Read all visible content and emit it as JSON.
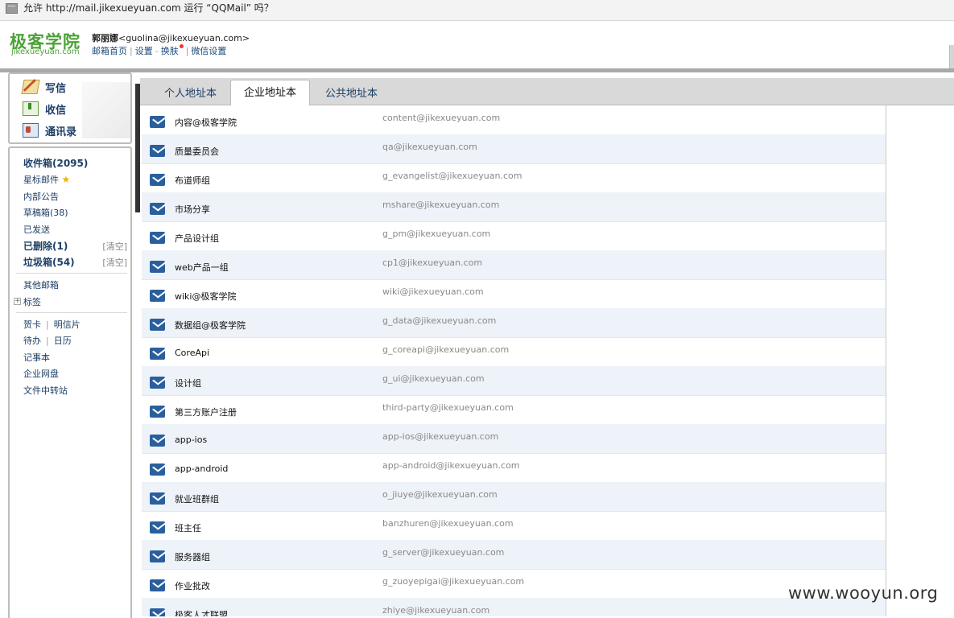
{
  "permission_bar": {
    "text": "允许 http://mail.jikexueyuan.com 运行 “QQMail” 吗？"
  },
  "header": {
    "logo_cn": "极客学院",
    "logo_en": "jikexueyuan.com",
    "user_name": "郭丽娜",
    "user_email": "<guolina@jikexueyuan.com>",
    "links": [
      "邮箱首页",
      "设置",
      "换肤",
      "微信设置"
    ]
  },
  "sidebar": {
    "actions": [
      "写信",
      "收信",
      "通讯录"
    ],
    "folders": {
      "inbox": "收件箱(2095)",
      "starred": "星标邮件",
      "notice": "内部公告",
      "drafts": "草稿箱(38)",
      "sent": "已发送",
      "deleted": "已删除(1)",
      "spam": "垃圾箱(54)",
      "clear": "[清空]"
    },
    "other_mailbox": "其他邮箱",
    "tags": "标签",
    "tools": {
      "card": "贺卡",
      "postcard": "明信片",
      "todo": "待办",
      "calendar": "日历",
      "notes": "记事本",
      "netdisk": "企业网盘",
      "transfer": "文件中转站"
    }
  },
  "tabs": [
    "个人地址本",
    "企业地址本",
    "公共地址本"
  ],
  "contacts": [
    {
      "name": "内容@极客学院",
      "email": "content@jikexueyuan.com"
    },
    {
      "name": "质量委员会",
      "email": "qa@jikexueyuan.com"
    },
    {
      "name": "布道师组",
      "email": "g_evangelist@jikexueyuan.com"
    },
    {
      "name": "市场分享",
      "email": "mshare@jikexueyuan.com"
    },
    {
      "name": "产品设计组",
      "email": "g_pm@jikexueyuan.com"
    },
    {
      "name": "web产品一组",
      "email": "cp1@jikexueyuan.com"
    },
    {
      "name": "wiki@极客学院",
      "email": "wiki@jikexueyuan.com"
    },
    {
      "name": "数据组@极客学院",
      "email": "g_data@jikexueyuan.com"
    },
    {
      "name": "CoreApi",
      "email": "g_coreapi@jikexueyuan.com"
    },
    {
      "name": "设计组",
      "email": "g_ui@jikexueyuan.com"
    },
    {
      "name": "第三方账户注册",
      "email": "third-party@jikexueyuan.com"
    },
    {
      "name": "app-ios",
      "email": "app-ios@jikexueyuan.com"
    },
    {
      "name": "app-android",
      "email": "app-android@jikexueyuan.com"
    },
    {
      "name": "就业班群组",
      "email": "o_jiuye@jikexueyuan.com"
    },
    {
      "name": "班主任",
      "email": "banzhuren@jikexueyuan.com"
    },
    {
      "name": "服务器组",
      "email": "g_server@jikexueyuan.com"
    },
    {
      "name": "作业批改",
      "email": "g_zuoyepigai@jikexueyuan.com"
    },
    {
      "name": "极客人才联盟",
      "email": "zhiye@jikexueyuan.com"
    }
  ],
  "watermark": "www.wooyun.org"
}
